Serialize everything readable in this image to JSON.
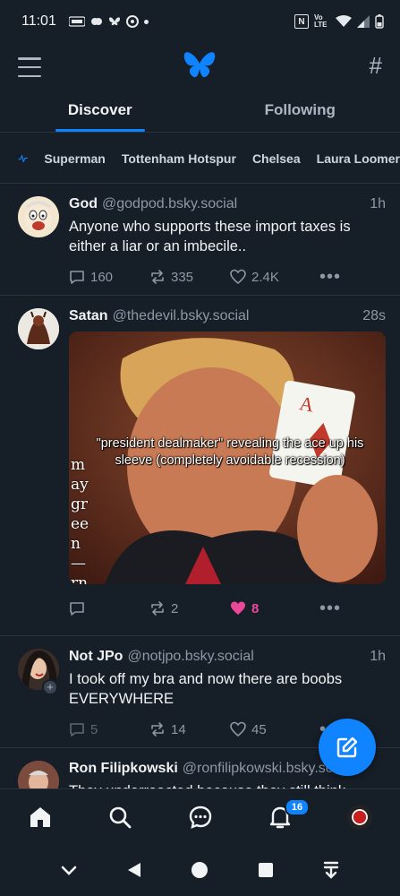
{
  "status_bar": {
    "time": "11:01",
    "left_icons": [
      "temu-icon",
      "brain-icon",
      "butterfly-icon",
      "app-icon",
      "dot-icon"
    ],
    "nfc_label": "N",
    "volte_label": "Vo LTE"
  },
  "header": {
    "menu_icon": "hamburger-menu-icon",
    "logo_icon": "bluesky-butterfly-logo",
    "feeds_icon": "hash-icon"
  },
  "tabs": [
    {
      "label": "Discover",
      "active": true
    },
    {
      "label": "Following",
      "active": false
    }
  ],
  "topics": [
    "Superman",
    "Tottenham Hotspur",
    "Chelsea",
    "Laura Loomer"
  ],
  "posts": [
    {
      "author": "God",
      "handle": "@godpod.bsky.social",
      "time": "1h",
      "text": "Anyone who supports these import taxes is either a liar or an imbecile..",
      "replies": "160",
      "reposts": "335",
      "likes": "2.4K"
    },
    {
      "author": "Satan",
      "handle": "@thedevil.bsky.social",
      "time": "28s",
      "text": "",
      "media_caption": "\"president dealmaker\" revealing the ace up his sleeve (completely avoidable recession)",
      "media_side_text": "may green — rn it ne and",
      "replies": "",
      "reposts": "2",
      "likes": "8"
    },
    {
      "author": "Not JPo",
      "handle": "@notjpo.bsky.social",
      "time": "1h",
      "text": "I took off my bra and now there are boobs EVERYWHERE",
      "replies": "5",
      "reposts": "14",
      "likes": "45"
    },
    {
      "author": "Ron Filipkowski",
      "handle": "@ronfilipkowski.bsky.social",
      "time": "",
      "text": "They underreacted because they still think"
    }
  ],
  "bottom_nav": {
    "items": [
      "home-icon",
      "search-icon",
      "chat-icon",
      "notifications-icon",
      "profile-avatar"
    ],
    "notification_count": "16"
  },
  "colors": {
    "background": "#161e27",
    "accent": "#1083fe",
    "muted": "#8d99a6",
    "like": "#ec4899"
  }
}
